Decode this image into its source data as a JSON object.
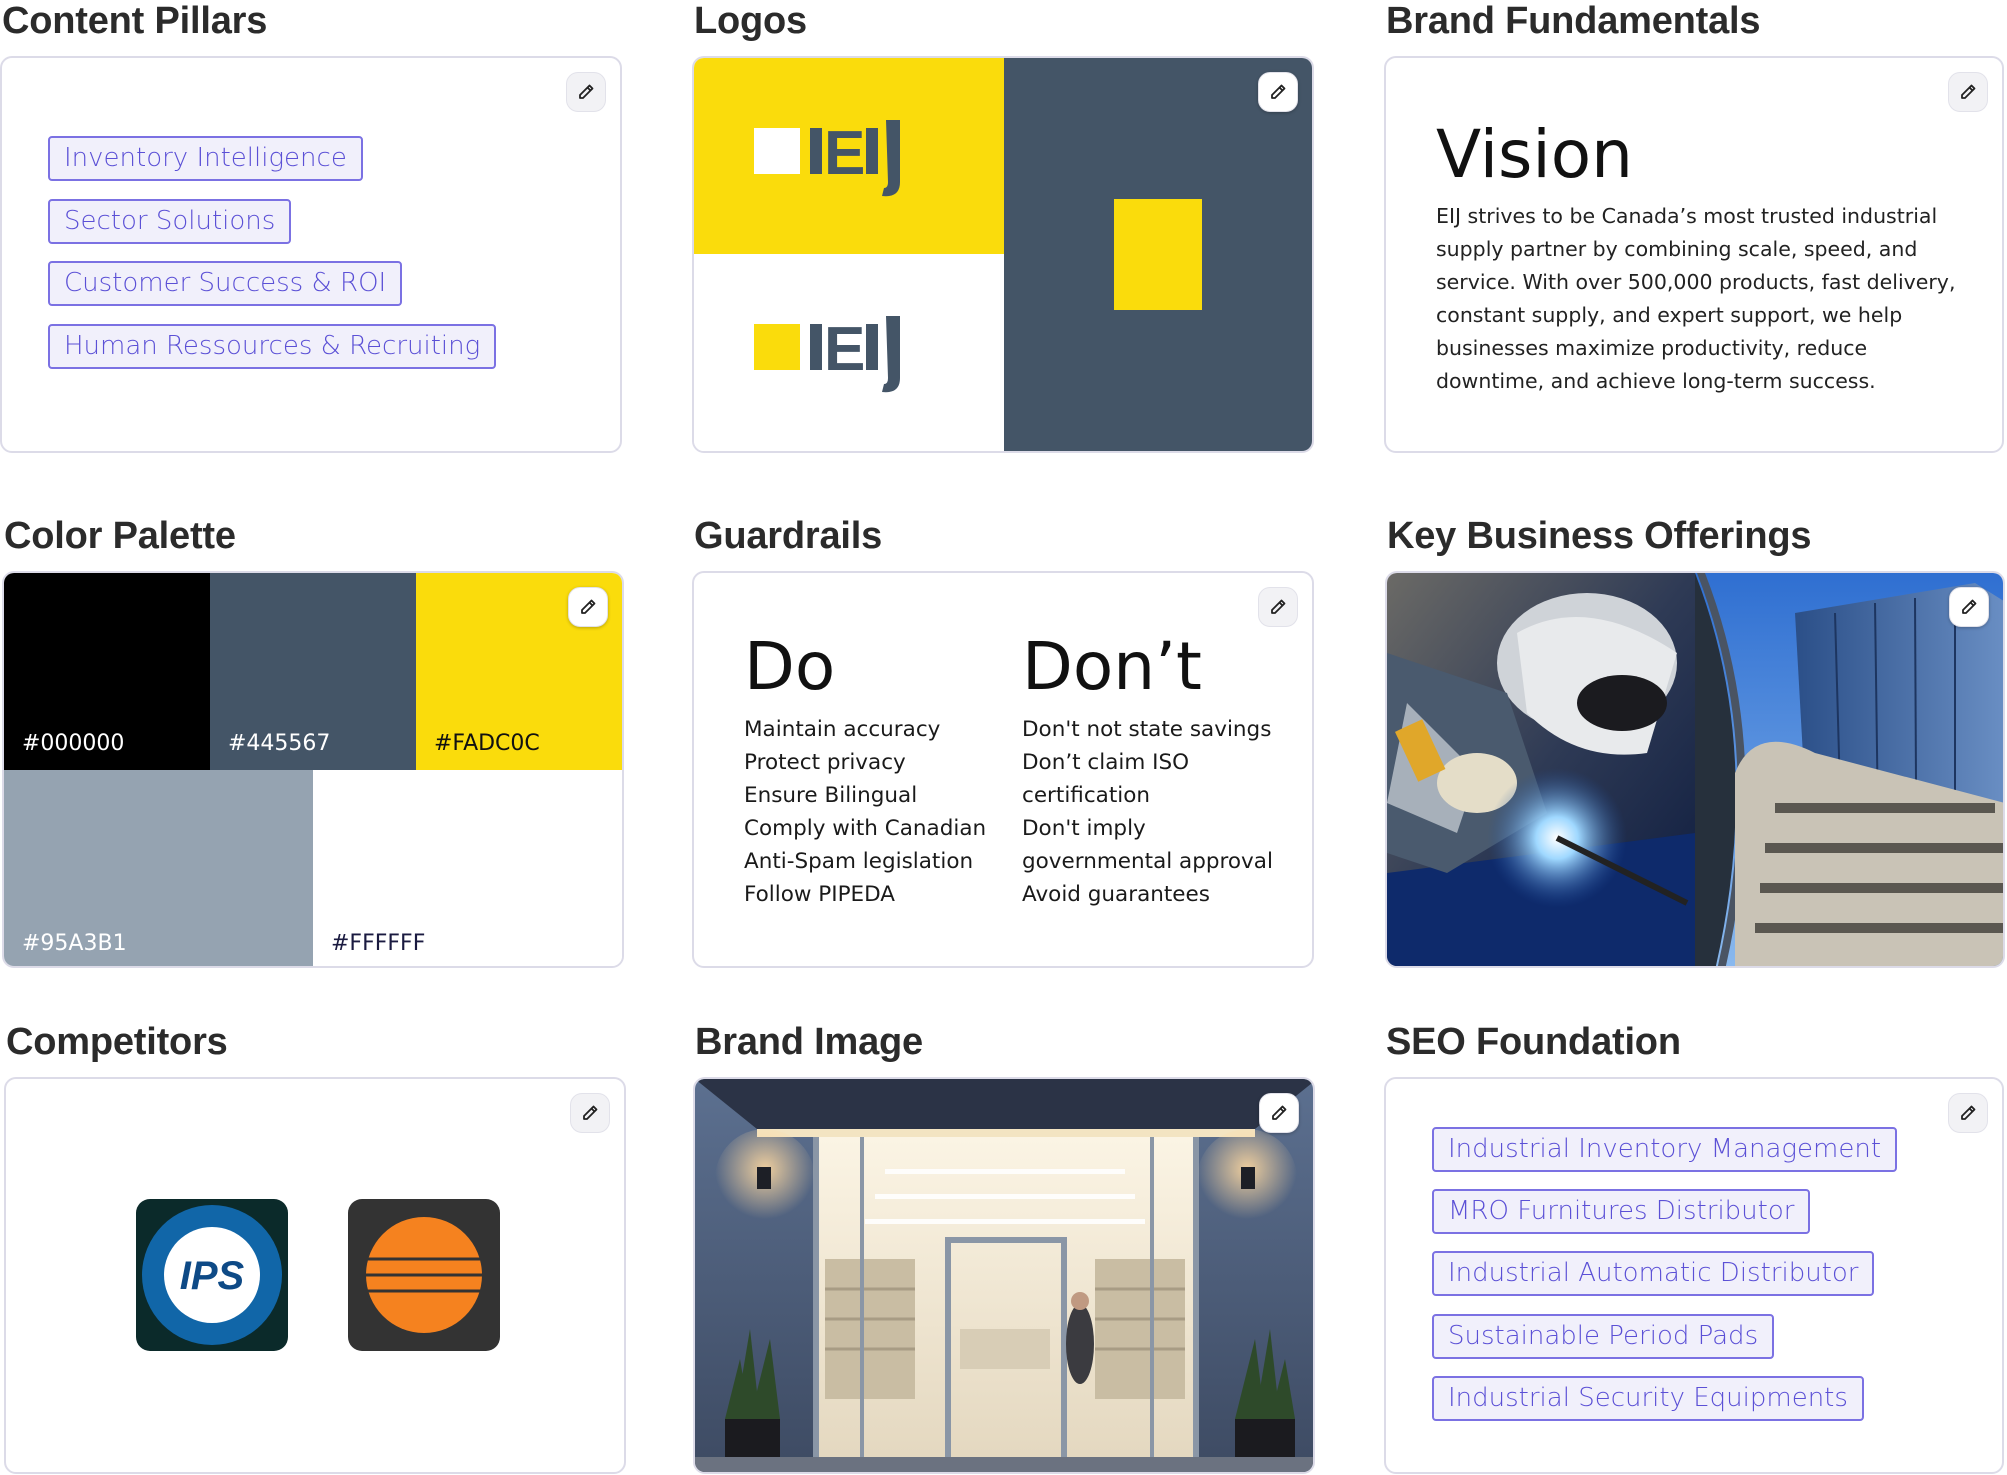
{
  "sections": {
    "content_pillars": {
      "title": "Content Pillars",
      "tags": [
        "Inventory Intelligence",
        "Sector Solutions",
        "Customer Success & ROI",
        "Human Ressources & Recruiting"
      ]
    },
    "logos": {
      "title": "Logos",
      "logo_text": "EIJ"
    },
    "brand_fundamentals": {
      "title": "Brand Fundamentals",
      "heading": "Vision",
      "body": "EIJ strives to be Canada’s most trusted industrial supply partner by combining scale, speed, and service. With over 500,000 products, fast delivery, constant supply, and expert support, we help businesses maximize productivity, reduce downtime, and achieve long-term success."
    },
    "color_palette": {
      "title": "Color Palette",
      "swatches": [
        {
          "hex": "#000000",
          "label": "#000000",
          "text_color": "#ffffff"
        },
        {
          "hex": "#445567",
          "label": "#445567",
          "text_color": "#ffffff"
        },
        {
          "hex": "#FADC0C",
          "label": "#FADC0C",
          "text_color": "#111111"
        },
        {
          "hex": "#95A3B1",
          "label": "#95A3B1",
          "text_color": "#ffffff"
        },
        {
          "hex": "#FFFFFF",
          "label": "#FFFFFF",
          "text_color": "#1a1a40"
        }
      ]
    },
    "guardrails": {
      "title": "Guardrails",
      "do_heading": "Do",
      "do_items": [
        "Maintain accuracy",
        "Protect privacy",
        "Ensure Bilingual",
        "Comply with Canadian",
        "Anti-Spam legislation",
        "Follow PIPEDA"
      ],
      "dont_heading": "Don’t",
      "dont_items": [
        "Don't not state savings",
        "Don’t claim ISO",
        "certification",
        "Don't imply",
        "governmental approval",
        "Avoid guarantees"
      ]
    },
    "key_business_offerings": {
      "title": "Key Business Offerings"
    },
    "competitors": {
      "title": "Competitors",
      "logos": [
        {
          "text": "IPS",
          "colors": {
            "bg": "#0b2a2a",
            "ring": "#1166a8",
            "inner": "#ffffff",
            "text": "#0e4a86"
          }
        },
        {
          "text": "",
          "colors": {
            "bg": "#333333",
            "circle": "#f5821f"
          }
        }
      ]
    },
    "brand_image": {
      "title": "Brand Image"
    },
    "seo_foundation": {
      "title": "SEO Foundation",
      "tags": [
        "Industrial Inventory Management",
        "MRO Furnitures Distributor",
        "Industrial Automatic Distributor",
        "Sustainable Period Pads",
        "Industrial Security Equipments"
      ]
    }
  },
  "icons": {
    "edit": "pencil-icon"
  },
  "colors": {
    "accent": "#5b50d6",
    "tag_border": "#7b71e3",
    "tag_bg": "#f1f0fb",
    "brand_yellow": "#FADC0C",
    "brand_slate": "#445567"
  }
}
